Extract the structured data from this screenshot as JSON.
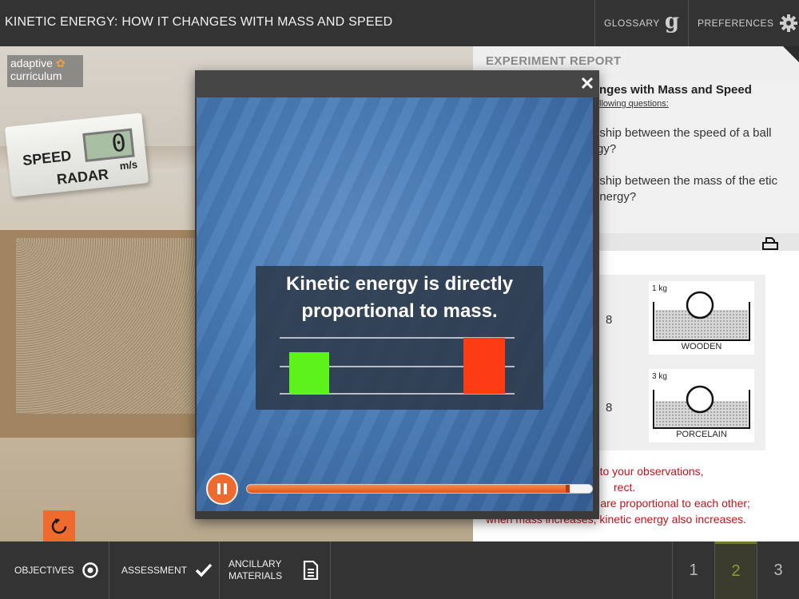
{
  "header": {
    "title": "KINETIC ENERGY: HOW IT CHANGES WITH MASS AND SPEED",
    "glossary_label": "GLOSSARY",
    "preferences_label": "PREFERENCES"
  },
  "scene": {
    "logo_line1": "adaptive",
    "logo_line2": "curriculum",
    "radar_speed_label": "SPEED",
    "radar_radar_label": "RADAR",
    "radar_unit": "m/s",
    "radar_value": "0"
  },
  "report": {
    "heading": "EXPERIMENT REPORT",
    "title": "nges with Mass and Speed",
    "subtitle": "llowing questions:",
    "q1": "nship between the speed of a ball rgy?",
    "q2": "nship between the mass of the etic energy?",
    "rows": [
      {
        "num": "8",
        "kg": "1 kg",
        "material": "WOODEN"
      },
      {
        "num": "8",
        "kg": "3 kg",
        "material": "PORCELAIN"
      }
    ],
    "answer_line1": "ing to your observations,",
    "answer_line2": "rect.",
    "answer_line3": "rgy are proportional to each other;",
    "answer_line4": "when mass increases, kinetic energy also increases."
  },
  "video": {
    "caption_line1": "Kinetic energy is directly",
    "caption_line2": "proportional to mass.",
    "bar_left_color": "#5ef21c",
    "bar_right_color": "#fe3c14",
    "progress_fraction": 0.93
  },
  "footer": {
    "objectives_label": "OBJECTIVES",
    "assessment_label": "ASSESSMENT",
    "ancillary_line1": "ANCILLARY",
    "ancillary_line2": "MATERIALS",
    "pages": [
      "1",
      "2",
      "3"
    ],
    "active_page": "2"
  },
  "colors": {
    "accent": "#ef6a2f",
    "answer_red": "#c0141c",
    "active_page": "#8aa030"
  }
}
